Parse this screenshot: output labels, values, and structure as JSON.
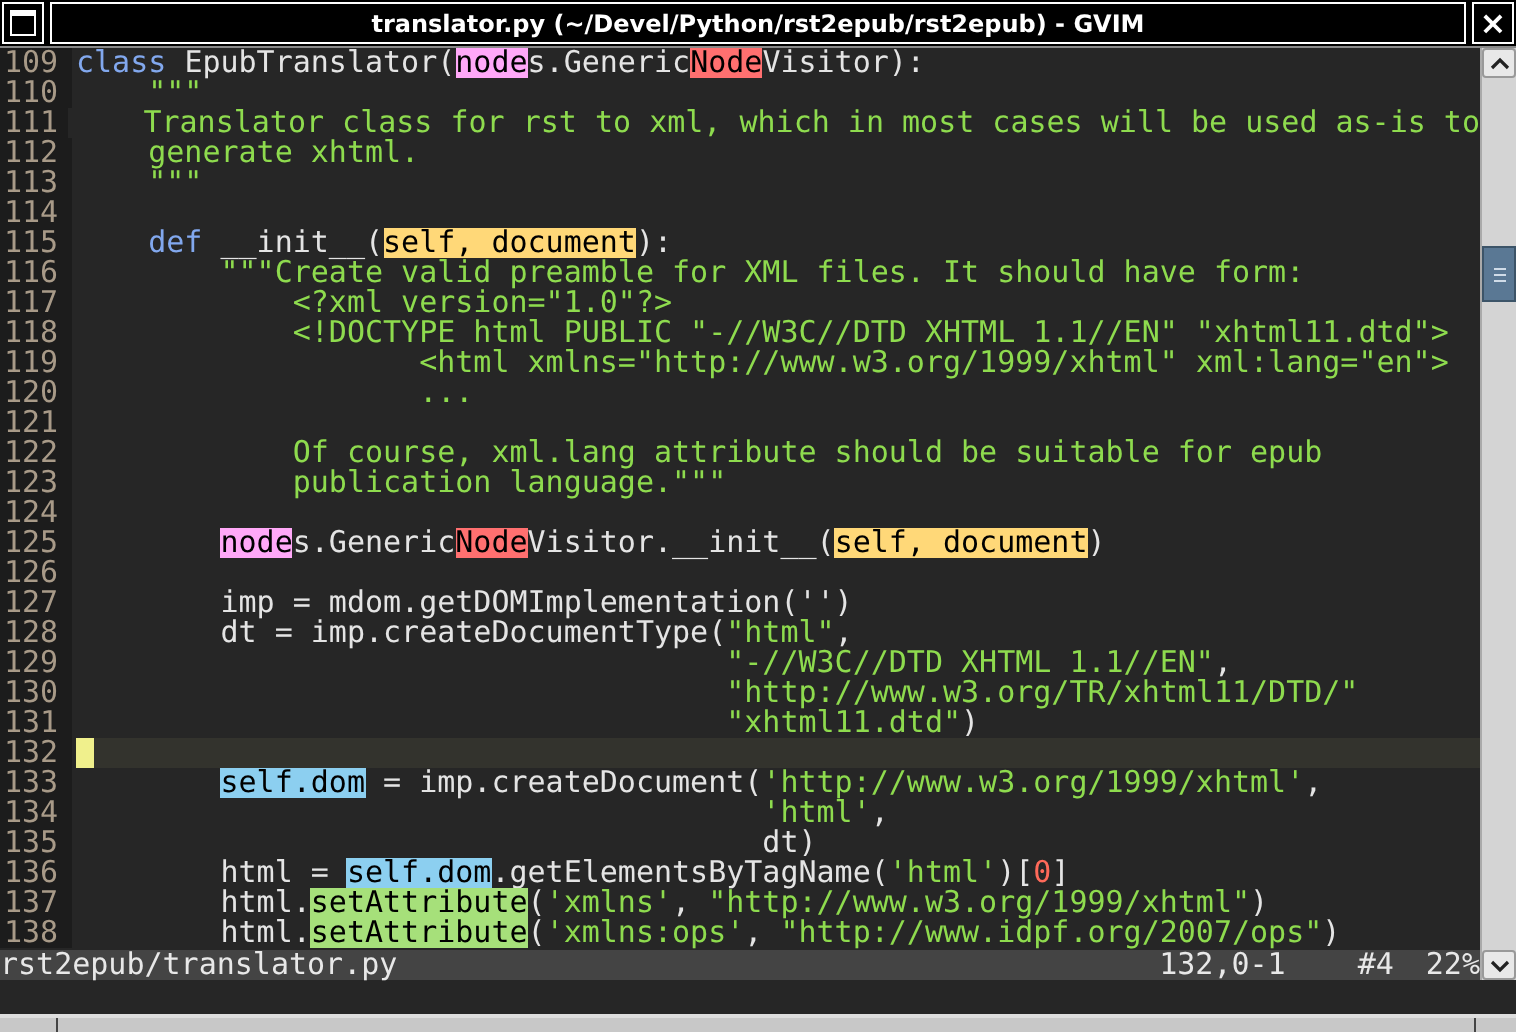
{
  "window": {
    "title": "translator.py (~/Devel/Python/rst2epub/rst2epub) - GVIM",
    "close": "×"
  },
  "lines": [
    {
      "number": "109",
      "current": false,
      "segments": [
        {
          "kind": "keyword",
          "text": "class"
        },
        {
          "kind": "text",
          "text": " EpubTranslator("
        },
        {
          "kind": "match",
          "color": "#ffa8f8",
          "text": "node"
        },
        {
          "kind": "text",
          "text": "s.Generic"
        },
        {
          "kind": "match",
          "color": "#ff7070",
          "text": "Node"
        },
        {
          "kind": "text",
          "text": "Visitor):"
        }
      ]
    },
    {
      "number": "110",
      "current": false,
      "segments": [
        {
          "kind": "string",
          "text": "    \"\"\""
        }
      ]
    },
    {
      "number": "111",
      "current": false,
      "segments": [
        {
          "kind": "string",
          "text": "    Translator class for rst to xml, which in most cases will be used as-is to"
        }
      ]
    },
    {
      "number": "112",
      "current": false,
      "segments": [
        {
          "kind": "string",
          "text": "    generate xhtml."
        }
      ]
    },
    {
      "number": "113",
      "current": false,
      "segments": [
        {
          "kind": "string",
          "text": "    \"\"\""
        }
      ]
    },
    {
      "number": "114",
      "current": false
    },
    {
      "number": "115",
      "current": false,
      "segments": [
        {
          "kind": "keyword",
          "text": "    def"
        },
        {
          "kind": "text",
          "text": " __init__("
        },
        {
          "kind": "match",
          "color": "#ffd878",
          "text": "self, document"
        },
        {
          "kind": "text",
          "text": "):"
        }
      ]
    },
    {
      "number": "116",
      "current": false,
      "segments": [
        {
          "kind": "string",
          "text": "        \"\"\"Create valid preamble for XML files. It should have form:"
        }
      ]
    },
    {
      "number": "117",
      "current": false,
      "segments": [
        {
          "kind": "string",
          "text": "            <?xml version=\"1.0\"?>"
        }
      ]
    },
    {
      "number": "118",
      "current": false,
      "segments": [
        {
          "kind": "string",
          "text": "            <!DOCTYPE html PUBLIC \"-//W3C//DTD XHTML 1.1//EN\" \"xhtml11.dtd\">"
        }
      ]
    },
    {
      "number": "119",
      "current": false,
      "segments": [
        {
          "kind": "string",
          "text": "                   <html xmlns=\"http://www.w3.org/1999/xhtml\" xml:lang=\"en\">"
        }
      ]
    },
    {
      "number": "120",
      "current": false,
      "segments": [
        {
          "kind": "string",
          "text": "                   ..."
        }
      ]
    },
    {
      "number": "121",
      "current": false
    },
    {
      "number": "122",
      "current": false,
      "segments": [
        {
          "kind": "string",
          "text": "            Of course, xml.lang attribute should be suitable for epub"
        }
      ]
    },
    {
      "number": "123",
      "current": false,
      "segments": [
        {
          "kind": "string",
          "text": "            publication language.\"\"\""
        }
      ]
    },
    {
      "number": "124",
      "current": false
    },
    {
      "number": "125",
      "current": false,
      "segments": [
        {
          "kind": "match",
          "color": "#ffa8f8",
          "text": "        node"
        },
        {
          "kind": "text",
          "text": "s.Generic"
        },
        {
          "kind": "match",
          "color": "#ff7070",
          "text": "Node"
        },
        {
          "kind": "text",
          "text": "Visitor.__init__("
        },
        {
          "kind": "match",
          "color": "#ffd878",
          "text": "self, document"
        },
        {
          "kind": "text",
          "text": ")"
        }
      ]
    },
    {
      "number": "126",
      "current": false
    },
    {
      "number": "127",
      "current": false,
      "segments": [
        {
          "kind": "text",
          "text": "        imp = mdom.getDOMImplementation('')"
        }
      ]
    },
    {
      "number": "128",
      "current": false,
      "segments": [
        {
          "kind": "text",
          "text": "        dt = imp.createDocumentType("
        },
        {
          "kind": "string",
          "text": "\"html\""
        },
        {
          "kind": "text",
          "text": ","
        }
      ]
    },
    {
      "number": "129",
      "current": false,
      "segments": [
        {
          "kind": "string",
          "text": "                                    \"-//W3C//DTD XHTML 1.1//EN\""
        },
        {
          "kind": "text",
          "text": ","
        }
      ]
    },
    {
      "number": "130",
      "current": false,
      "segments": [
        {
          "kind": "string",
          "text": "                                    \"http://www.w3.org/TR/xhtml11/DTD/\""
        }
      ]
    },
    {
      "number": "131",
      "current": false,
      "segments": [
        {
          "kind": "string",
          "text": "                                    \"xhtml11.dtd\""
        },
        {
          "kind": "text",
          "text": ")"
        }
      ]
    },
    {
      "number": "132",
      "current": true
    },
    {
      "number": "133",
      "current": false,
      "segments": [
        {
          "kind": "match",
          "color": "#8ccff0",
          "text": "        self.dom"
        },
        {
          "kind": "text",
          "text": " = imp.createDocument("
        },
        {
          "kind": "string",
          "text": "'http://www.w3.org/1999/xhtml'"
        },
        {
          "kind": "text",
          "text": ","
        }
      ]
    },
    {
      "number": "134",
      "current": false,
      "segments": [
        {
          "kind": "string",
          "text": "                                      'html'"
        },
        {
          "kind": "text",
          "text": ","
        }
      ]
    },
    {
      "number": "135",
      "current": false,
      "segments": [
        {
          "kind": "text",
          "text": "                                      dt)"
        }
      ]
    },
    {
      "number": "136",
      "current": false,
      "segments": [
        {
          "kind": "text",
          "text": "        html = "
        },
        {
          "kind": "match",
          "color": "#8ccff0",
          "text": "self.dom"
        },
        {
          "kind": "text",
          "text": ".getElementsByTagName("
        },
        {
          "kind": "string",
          "text": "'html'"
        },
        {
          "kind": "text",
          "text": ")["
        },
        {
          "kind": "number",
          "text": "0"
        },
        {
          "kind": "text",
          "text": "]"
        }
      ]
    },
    {
      "number": "137",
      "current": false,
      "segments": [
        {
          "kind": "text",
          "text": "        html."
        },
        {
          "kind": "match",
          "color": "#a6e07a",
          "text": "setAttribute"
        },
        {
          "kind": "text",
          "text": "("
        },
        {
          "kind": "string",
          "text": "'xmlns'"
        },
        {
          "kind": "text",
          "text": ", "
        },
        {
          "kind": "string",
          "text": "\"http://www.w3.org/1999/xhtml\""
        },
        {
          "kind": "text",
          "text": ")"
        }
      ]
    },
    {
      "number": "138",
      "current": false,
      "segments": [
        {
          "kind": "text",
          "text": "        html."
        },
        {
          "kind": "match",
          "color": "#a6e07a",
          "text": "setAttribute"
        },
        {
          "kind": "text",
          "text": "("
        },
        {
          "kind": "string",
          "text": "'xmlns:ops'"
        },
        {
          "kind": "text",
          "text": ", "
        },
        {
          "kind": "string",
          "text": "\"http://www.idpf.org/2007/ops\""
        },
        {
          "kind": "text",
          "text": ")"
        }
      ]
    }
  ],
  "status_bar": {
    "file": "rst2epub/translator.py",
    "position": "132,0-1",
    "buffer": "#4",
    "percent": "22%"
  }
}
